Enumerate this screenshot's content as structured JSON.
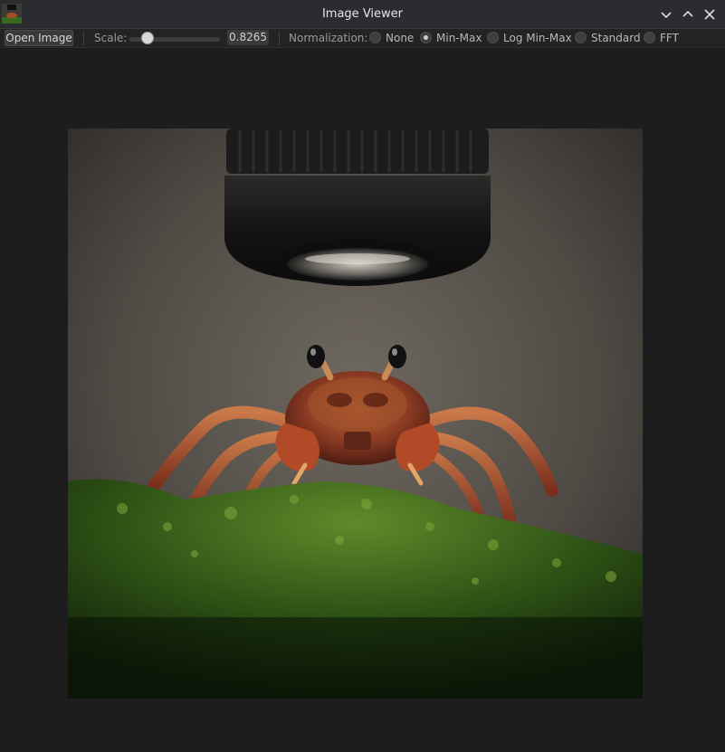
{
  "window": {
    "title": "Image Viewer",
    "app_icon": "crab-thumbnail-icon",
    "controls": [
      "minimize-icon",
      "maximize-icon",
      "close-icon"
    ]
  },
  "toolbar": {
    "open_label": "Open Image",
    "scale_label": "Scale:",
    "scale_value": "0.8265",
    "scale_fraction": 0.2,
    "normalization_label": "Normalization:",
    "normalization_options": [
      {
        "label": "None",
        "checked": false
      },
      {
        "label": "Min-Max",
        "checked": true
      },
      {
        "label": "Log Min-Max",
        "checked": false
      },
      {
        "label": "Standard",
        "checked": false
      },
      {
        "label": "FFT",
        "checked": false
      }
    ]
  },
  "image": {
    "subject": "crab on moss under microscope lens",
    "colors": {
      "background": "#1d1d1d",
      "moss": "#3f6a1c",
      "crab": "#a0502a",
      "lens": "#1a1a1a"
    }
  }
}
